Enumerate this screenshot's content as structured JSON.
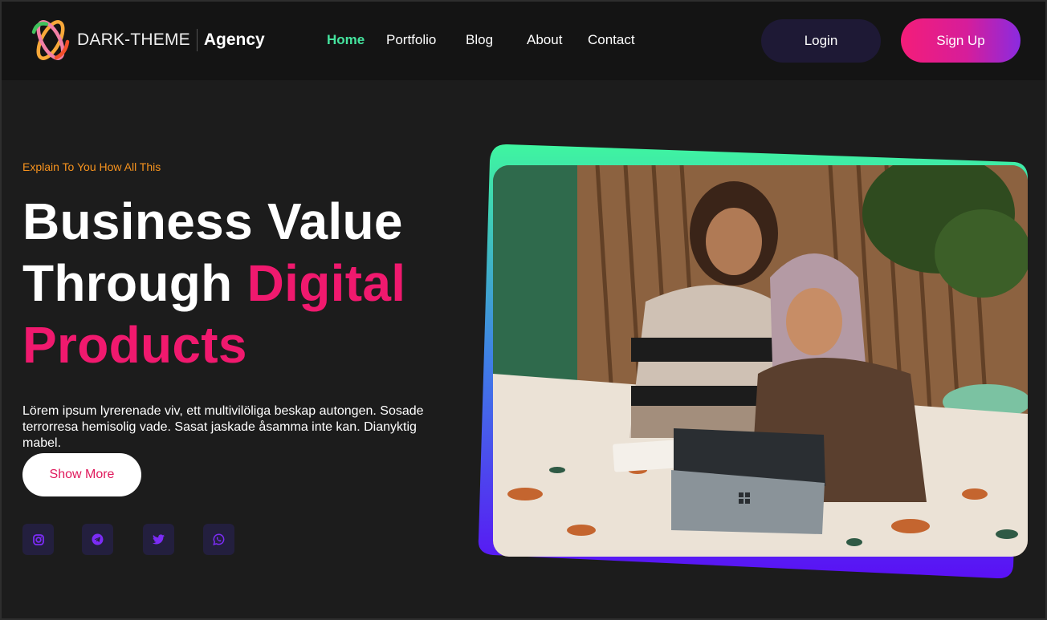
{
  "brand": {
    "name": "DARK-THEME",
    "suffix": "Agency"
  },
  "nav": {
    "items": [
      {
        "label": "Home",
        "active": true
      },
      {
        "label": "Portfolio",
        "active": false
      },
      {
        "label": "Blog",
        "active": false
      },
      {
        "label": "About",
        "active": false
      },
      {
        "label": "Contact",
        "active": false
      }
    ]
  },
  "auth": {
    "login_label": "Login",
    "signup_label": "Sign Up"
  },
  "hero": {
    "eyebrow": "Explain To You How All This",
    "title_line1": "Business Value",
    "title_line2_plain": "Through ",
    "title_line2_accent": "Digital",
    "title_line3_accent": "Products",
    "description": "Lörem ipsum lyrerenade viv, ett multivilöliga beskap autongen. Sosade terrorresa hemisolig vade. Sasat jaskade åsamma inte kan. Dianyktig mabel.",
    "cta_label": "Show More"
  },
  "socials": [
    {
      "icon": "instagram-icon"
    },
    {
      "icon": "telegram-icon"
    },
    {
      "icon": "twitter-icon"
    },
    {
      "icon": "whatsapp-icon"
    }
  ],
  "colors": {
    "background": "#1c1c1c",
    "header": "#141414",
    "accent_pink": "#f0196e",
    "accent_green": "#45e39e",
    "eyebrow_orange": "#f7931e",
    "social_bg": "#231f3e",
    "social_icon": "#7b2cf5"
  }
}
